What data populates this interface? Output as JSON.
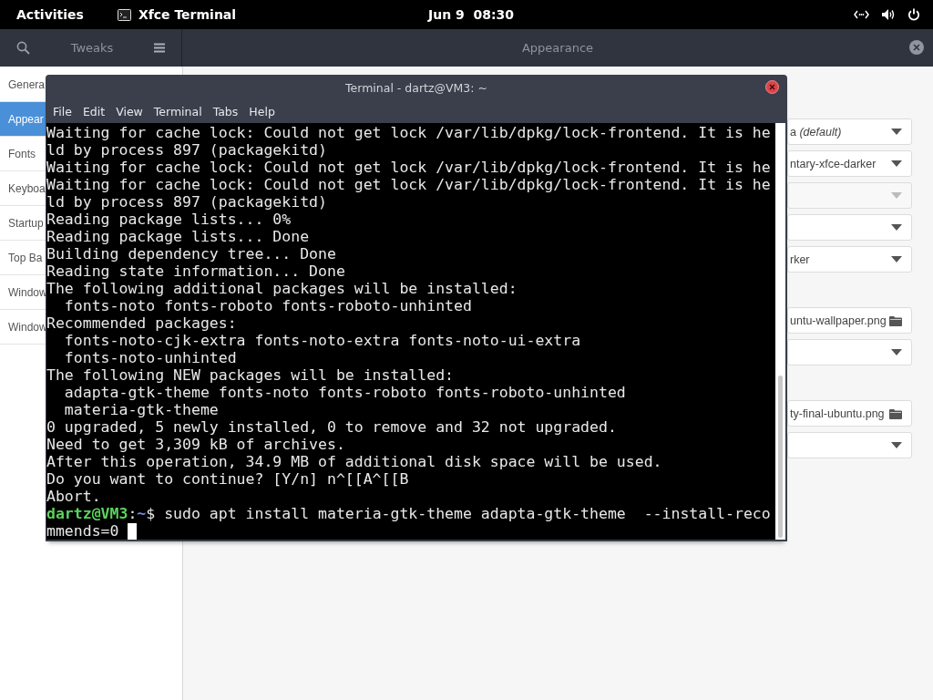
{
  "top_bar": {
    "activities": "Activities",
    "app_name": "Xfce Terminal",
    "clock": "Jun 9  08:30"
  },
  "tweaks": {
    "title": "Tweaks",
    "panel_title": "Appearance",
    "sidebar": [
      {
        "label": "Genera",
        "selected": false
      },
      {
        "label": "Appear",
        "selected": true
      },
      {
        "label": "Fonts",
        "selected": false
      },
      {
        "label": "Keyboa",
        "selected": false
      },
      {
        "label": "Startup",
        "selected": false
      },
      {
        "label": "Top Ba",
        "selected": false
      },
      {
        "label": "Window",
        "selected": false
      },
      {
        "label": "Window",
        "selected": false
      }
    ],
    "sections": [
      {
        "controls": [
          {
            "kind": "dropdown",
            "value": "a *(default)*",
            "disabled": false
          },
          {
            "kind": "dropdown",
            "value": "ntary-xfce-darker",
            "disabled": false
          },
          {
            "kind": "dropdown",
            "disabled": true
          },
          {
            "kind": "dropdown",
            "disabled": false
          },
          {
            "kind": "dropdown",
            "value": "rker",
            "disabled": false
          }
        ]
      },
      {
        "controls": [
          {
            "kind": "file",
            "value": "untu-wallpaper.png"
          },
          {
            "kind": "dropdown",
            "disabled": false
          }
        ]
      },
      {
        "controls": [
          {
            "kind": "file",
            "value": "ty-final-ubuntu.png"
          },
          {
            "kind": "dropdown",
            "disabled": false
          }
        ]
      }
    ]
  },
  "terminal": {
    "title": "Terminal - dartz@VM3: ~",
    "menu": [
      "File",
      "Edit",
      "View",
      "Terminal",
      "Tabs",
      "Help"
    ],
    "lines": [
      {
        "kind": "output",
        "text": "Waiting for cache lock: Could not get lock /var/lib/dpkg/lock-frontend. It is he"
      },
      {
        "kind": "output",
        "text": "ld by process 897 (packagekitd)"
      },
      {
        "kind": "output",
        "text": "Waiting for cache lock: Could not get lock /var/lib/dpkg/lock-frontend. It is he"
      },
      {
        "kind": "output",
        "text": "Waiting for cache lock: Could not get lock /var/lib/dpkg/lock-frontend. It is he"
      },
      {
        "kind": "output",
        "text": "ld by process 897 (packagekitd)"
      },
      {
        "kind": "output",
        "text": "Reading package lists... 0%"
      },
      {
        "kind": "output",
        "text": "Reading package lists... Done"
      },
      {
        "kind": "output",
        "text": "Building dependency tree... Done"
      },
      {
        "kind": "output",
        "text": "Reading state information... Done"
      },
      {
        "kind": "output",
        "text": "The following additional packages will be installed:"
      },
      {
        "kind": "output",
        "text": "  fonts-noto fonts-roboto fonts-roboto-unhinted"
      },
      {
        "kind": "output",
        "text": "Recommended packages:"
      },
      {
        "kind": "output",
        "text": "  fonts-noto-cjk-extra fonts-noto-extra fonts-noto-ui-extra"
      },
      {
        "kind": "output",
        "text": "  fonts-noto-unhinted"
      },
      {
        "kind": "output",
        "text": "The following NEW packages will be installed:"
      },
      {
        "kind": "output",
        "text": "  adapta-gtk-theme fonts-noto fonts-roboto fonts-roboto-unhinted"
      },
      {
        "kind": "output",
        "text": "  materia-gtk-theme"
      },
      {
        "kind": "output",
        "text": "0 upgraded, 5 newly installed, 0 to remove and 32 not upgraded."
      },
      {
        "kind": "output",
        "text": "Need to get 3,309 kB of archives."
      },
      {
        "kind": "output",
        "text": "After this operation, 34.9 MB of additional disk space will be used."
      },
      {
        "kind": "output",
        "text": "Do you want to continue? [Y/n] n^[[A^[[B"
      },
      {
        "kind": "output",
        "text": "Abort."
      },
      {
        "kind": "prompt",
        "user": "dartz@VM3",
        "separator": ":",
        "path": "~",
        "text": "$ sudo apt install materia-gtk-theme adapta-gtk-theme  --install-reco"
      },
      {
        "kind": "output",
        "text": "mmends=0",
        "cursor": true
      }
    ]
  }
}
